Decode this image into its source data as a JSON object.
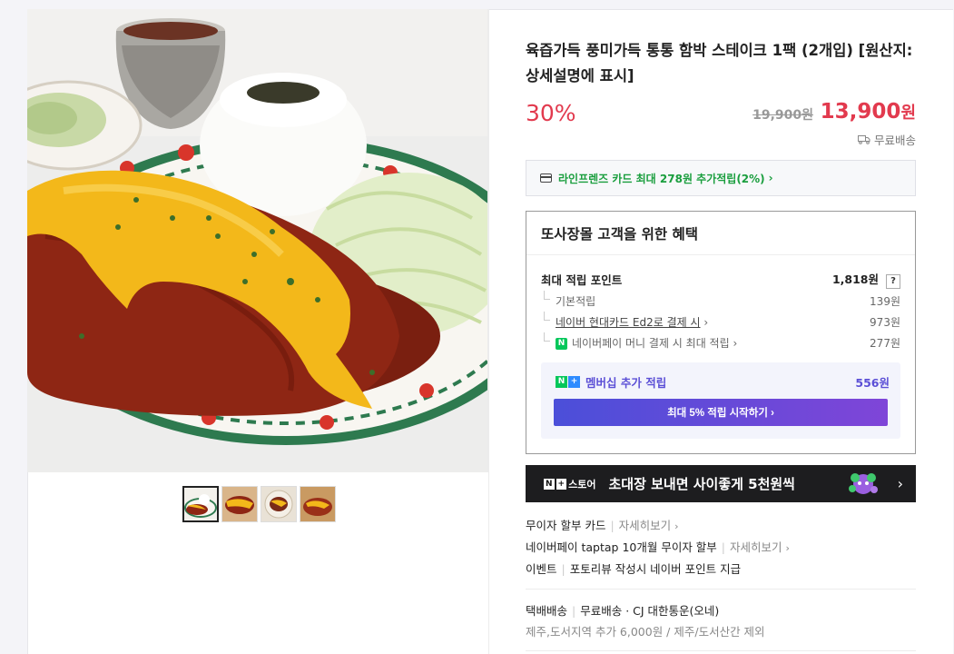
{
  "product": {
    "title": "육즙가득 풍미가득 통통 함박 스테이크 1팩 (2개입) [원산지:상세설명에 표시]",
    "discount": "30%",
    "original_price": "19,900원",
    "sale_price": "13,900",
    "sale_price_unit": "원",
    "shipping_tag": "무료배송"
  },
  "card_benefit": {
    "text": "라인프렌즈 카드 최대 278원 추가적립(2%)",
    "chevron": "›"
  },
  "benefits": {
    "title": "또사장몰 고객을 위한 혜택",
    "max_points_label": "최대 적립 포인트",
    "max_points_value": "1,818원",
    "help_badge": "?",
    "rows": [
      {
        "label": "기본적립",
        "value": "139원"
      },
      {
        "label": "네이버 현대카드 Ed2로 결제 시",
        "value": "973원"
      },
      {
        "label": "네이버페이 머니 결제 시 최대 적립",
        "value": "277원"
      }
    ],
    "npay_badge": "N",
    "membership": {
      "badge_n": "N",
      "badge_plus": "+",
      "label": "멤버십 추가 적립",
      "value": "556원",
      "button_label": "최대 5% 적립 시작하기 ›"
    }
  },
  "banner": {
    "logo_n": "N",
    "logo_plus": "+",
    "logo_text": "스토어",
    "text": "초대장 보내면 사이좋게 5천원씩",
    "arrow": "›"
  },
  "info": {
    "item1_label": "무이자 할부 카드",
    "item1_link": "자세히보기",
    "item2_label": "네이버페이 taptap 10개월 무이자 할부",
    "item2_link": "자세히보기",
    "item3_label": "이벤트",
    "item3_text": "포토리뷰 작성시 네이버 포인트 지급",
    "chevron": "›",
    "sep": "|"
  },
  "shipping": {
    "label": "택배배송",
    "value": "무료배송 · CJ 대한통운(오네)",
    "note": "제주,도서지역 추가 6,000원 / 제주/도서산간 제외"
  },
  "gallery": {
    "main_image": "hamburg-steak-plate",
    "thumbnails": [
      "thumb-1",
      "thumb-2",
      "thumb-3",
      "thumb-4"
    ]
  }
}
